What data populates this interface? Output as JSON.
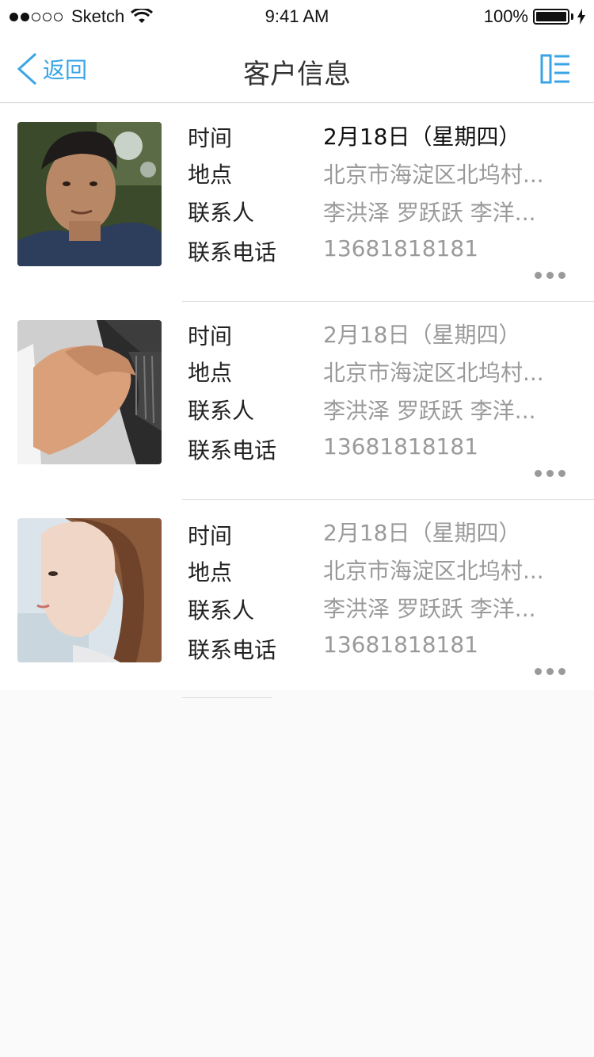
{
  "status_bar": {
    "carrier": "Sketch",
    "time": "9:41 AM",
    "battery": "100%"
  },
  "nav": {
    "back_label": "返回",
    "title": "客户信息"
  },
  "labels": {
    "time": "时间",
    "place": "地点",
    "contact": "联系人",
    "phone": "联系电话"
  },
  "customers": [
    {
      "date": "2月18日（星期四）",
      "place": "北京市海淀区北坞村...",
      "contacts": "李洪泽  罗跃跃  李洋...",
      "phone": "13681818181",
      "photo": "young-man-portrait"
    },
    {
      "date": "2月18日（星期四）",
      "place": "北京市海淀区北坞村...",
      "contacts": "李洪泽  罗跃跃  李洋...",
      "phone": "13681818181",
      "photo": "handshake"
    },
    {
      "date": "2月18日（星期四）",
      "place": "北京市海淀区北坞村...",
      "contacts": "李洪泽  罗跃跃  李洋...",
      "phone": "13681818181",
      "photo": "young-woman-portrait"
    }
  ],
  "colors": {
    "accent": "#3aa5e6",
    "label": "#222222",
    "value_muted": "#9a9a9a",
    "background": "#fafafa"
  }
}
